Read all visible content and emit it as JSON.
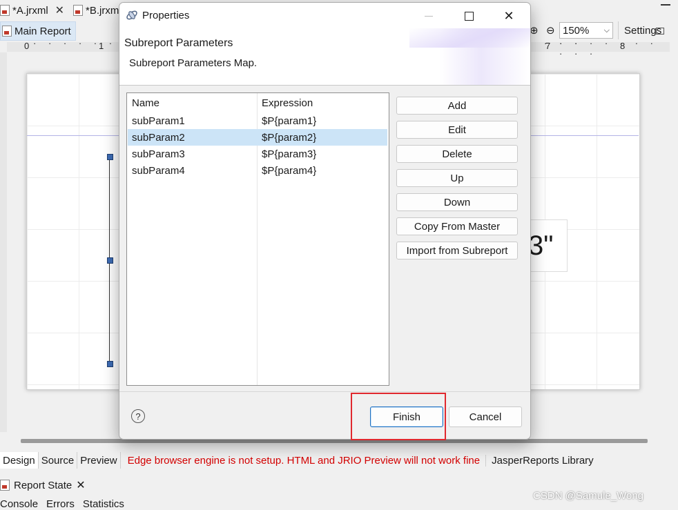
{
  "editor_tabs": [
    {
      "label": "*A.jrxml"
    },
    {
      "label": "*B.jrxm"
    }
  ],
  "sub_tab": {
    "label": "Main Report"
  },
  "toolbar": {
    "zoom": "150%",
    "settings": "Settings"
  },
  "ruler": {
    "marks": [
      "0",
      "1",
      "7",
      "8"
    ]
  },
  "canvas_text": "3\"",
  "bottom_tabs": [
    "Design",
    "Source",
    "Preview"
  ],
  "warning": "Edge browser engine is not setup. HTML and JRIO Preview will not work fine",
  "library_tab": "JasperReports Library",
  "panel": {
    "title": "Report State",
    "tabs": [
      "Console",
      "Errors",
      "Statistics"
    ]
  },
  "watermark": "CSDN @Samule_Wong",
  "dialog": {
    "title": "Properties",
    "header_title": "Subreport Parameters",
    "header_desc": "Subreport Parameters Map.",
    "columns": {
      "name": "Name",
      "expression": "Expression"
    },
    "rows": [
      {
        "name": "subParam1",
        "expression": "$P{param1}",
        "selected": false
      },
      {
        "name": "subParam2",
        "expression": "$P{param2}",
        "selected": true
      },
      {
        "name": "subParam3",
        "expression": "$P{param3}",
        "selected": false
      },
      {
        "name": "subParam4",
        "expression": "$P{param4}",
        "selected": false
      }
    ],
    "buttons": {
      "add": "Add",
      "edit": "Edit",
      "delete": "Delete",
      "up": "Up",
      "down": "Down",
      "copy_from_master": "Copy From Master",
      "import_from_subreport": "Import from Subreport"
    },
    "finish": "Finish",
    "cancel": "Cancel",
    "help_icon": "help-icon"
  },
  "colors": {
    "selection": "#cce4f7",
    "warning": "#d40000",
    "highlight_box": "#e0282e",
    "accent": "#1b6fc2"
  }
}
